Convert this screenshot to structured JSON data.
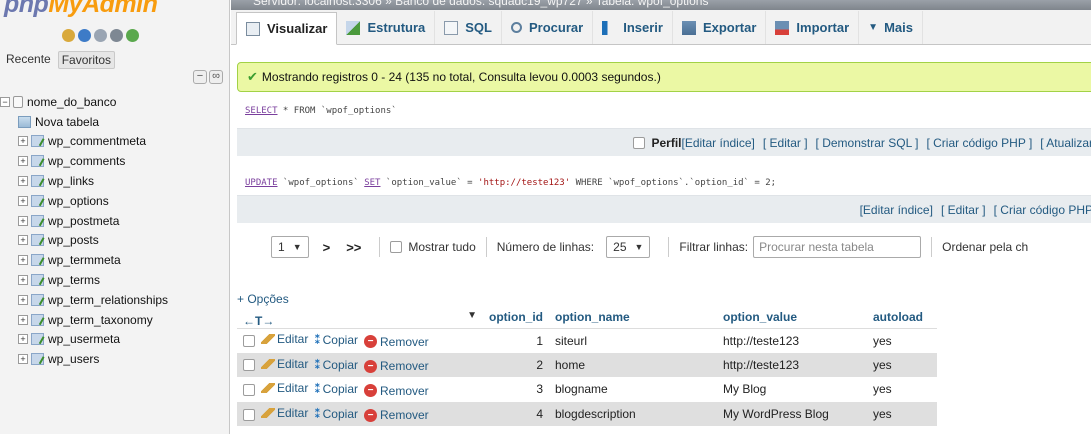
{
  "nav": {
    "logo_php": "php",
    "logo_my": "My",
    "logo_admin": "Admin",
    "tab_recent": "Recente",
    "tab_favorites": "Favoritos",
    "database": "nome_do_banco",
    "new_table": "Nova tabela",
    "tables": [
      "wp_commentmeta",
      "wp_comments",
      "wp_links",
      "wp_options",
      "wp_postmeta",
      "wp_posts",
      "wp_termmeta",
      "wp_terms",
      "wp_term_relationships",
      "wp_term_taxonomy",
      "wp_usermeta",
      "wp_users"
    ]
  },
  "breadcrumb": "Servidor: localhost:3306 » Banco de dados: squadc19_wp727 » Tabela: wpof_options",
  "tabs": [
    {
      "label": "Visualizar"
    },
    {
      "label": "Estrutura"
    },
    {
      "label": "SQL"
    },
    {
      "label": "Procurar"
    },
    {
      "label": "Inserir"
    },
    {
      "label": "Exportar"
    },
    {
      "label": "Importar"
    },
    {
      "label": "Mais"
    }
  ],
  "success_message": "Mostrando registros 0 - 24 (135 no total, Consulta levou 0.0003 segundos.)",
  "query1": {
    "kw_select": "SELECT",
    "rest": " * FROM `wpof_options`"
  },
  "linkbar1": {
    "perfil": "Perfil",
    "links": [
      "[Editar índice]",
      "[ Editar ]",
      "[ Demonstrar SQL ]",
      "[ Criar código PHP ]",
      "[ Atualizar"
    ]
  },
  "query2": {
    "kw_update": "UPDATE",
    "part1": " `wpof_options` ",
    "kw_set": "SET",
    "part2": " `option_value` = ",
    "str": "'http://teste123'",
    "part3": " WHERE `wpof_options`.`option_id` = 2;"
  },
  "linkbar2": {
    "links": [
      "[Editar índice]",
      "[ Editar ]",
      "[ Criar código PHP"
    ]
  },
  "navigator": {
    "page": "1",
    "next": ">",
    "last": ">>",
    "show_all": "Mostrar tudo",
    "rows_label": "Número de linhas:",
    "rows_value": "25",
    "filter_label": "Filtrar linhas:",
    "filter_placeholder": "Procurar nesta tabela",
    "sort_label": "Ordenar pela ch"
  },
  "options_link": "+ Opções",
  "resize_tool": "←T→",
  "columns": [
    "option_id",
    "option_name",
    "option_value",
    "autoload"
  ],
  "actions": {
    "edit": "Editar",
    "copy": "Copiar",
    "delete": "Remover"
  },
  "rows": [
    {
      "option_id": "1",
      "option_name": "siteurl",
      "option_value": "http://teste123",
      "autoload": "yes"
    },
    {
      "option_id": "2",
      "option_name": "home",
      "option_value": "http://teste123",
      "autoload": "yes"
    },
    {
      "option_id": "3",
      "option_name": "blogname",
      "option_value": "My Blog",
      "autoload": "yes"
    },
    {
      "option_id": "4",
      "option_name": "blogdescription",
      "option_value": "My WordPress Blog",
      "autoload": "yes"
    }
  ],
  "colors": {
    "link": "#235a81",
    "success_bg": "#ebf8a4",
    "logo_php": "#6c78af",
    "logo_admin": "#f89c0e"
  }
}
